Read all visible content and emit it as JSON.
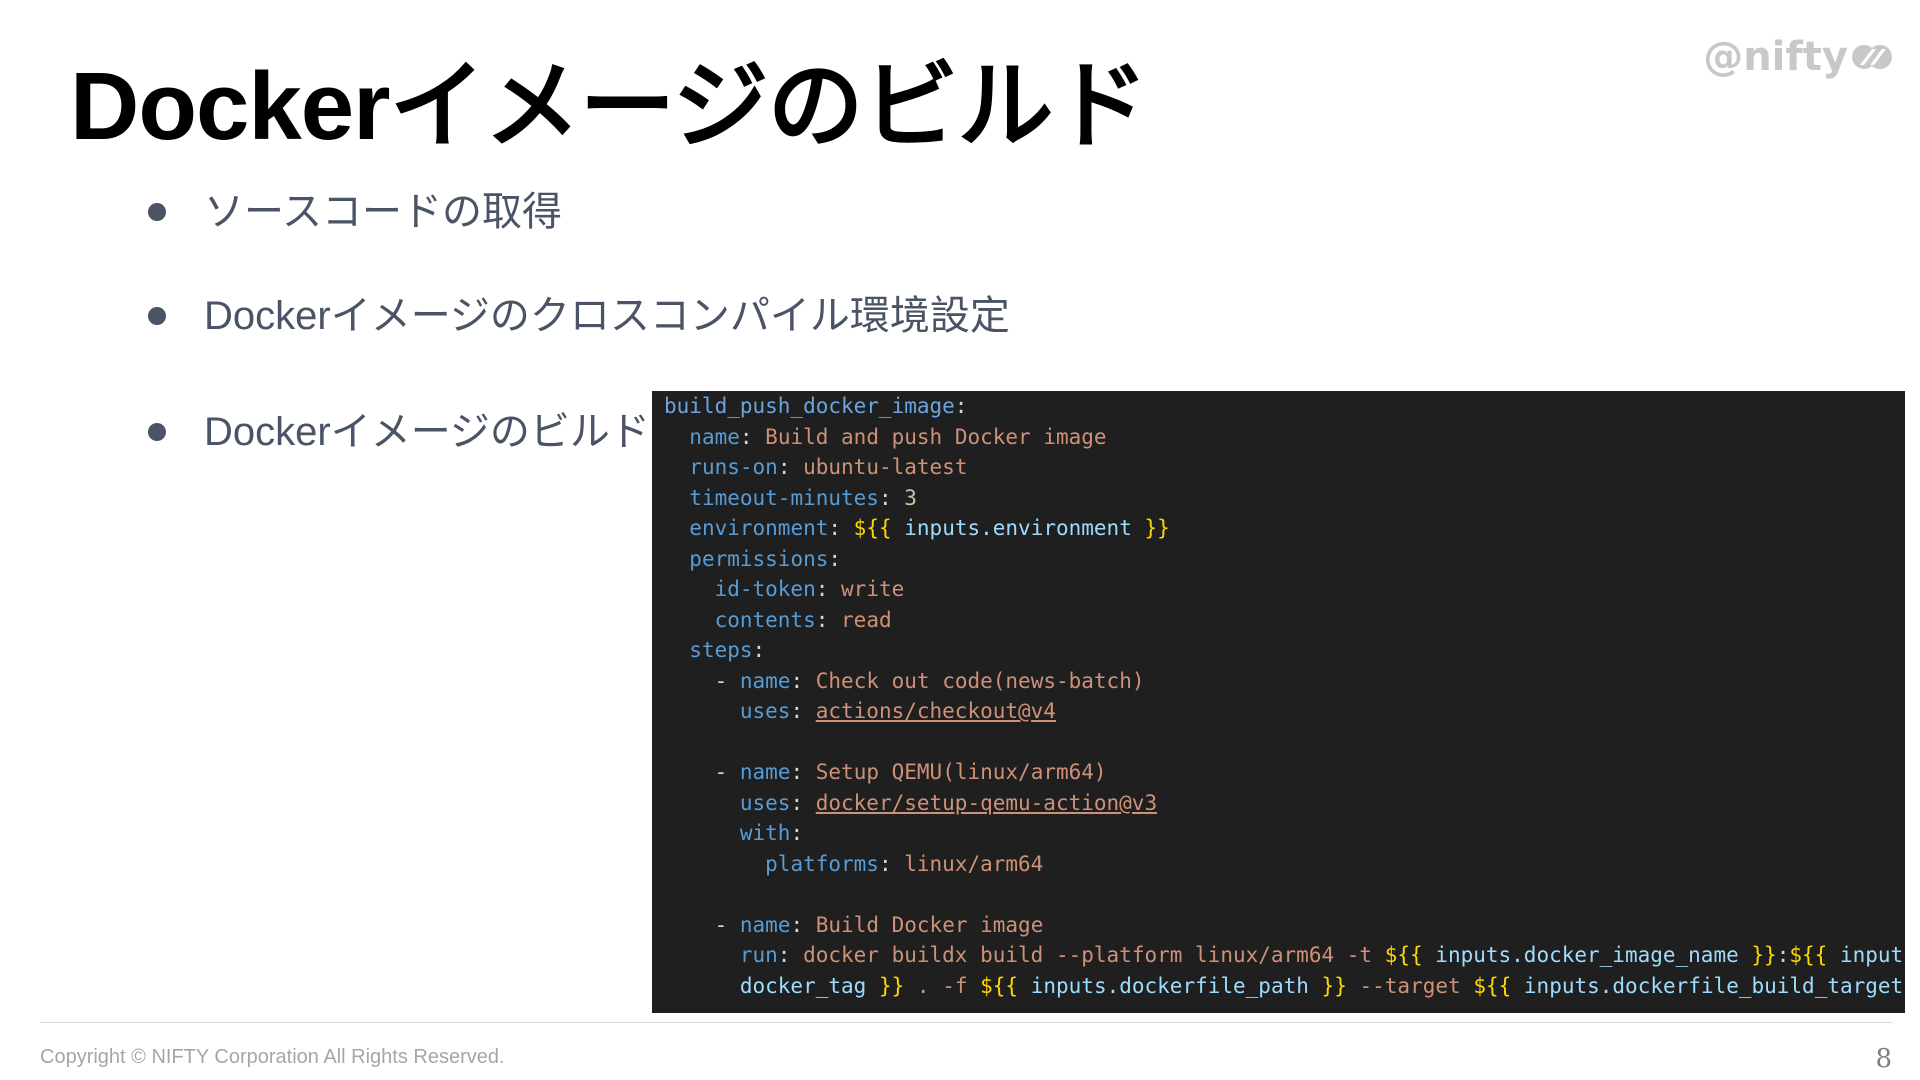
{
  "slide": {
    "title": "Dockerイメージのビルド",
    "logo_text": "@nifty",
    "bullets": [
      "ソースコードの取得",
      "Dockerイメージのクロスコンパイル環境設定",
      "Dockerイメージのビルド"
    ],
    "footer": {
      "copyright": "Copyright © NIFTY Corporation All Rights Reserved.",
      "page_number": "8"
    }
  },
  "code": {
    "job_key": "build_push_docker_image",
    "name_key": "name",
    "name_value": "Build and push Docker image",
    "runs_on_key": "runs-on",
    "runs_on_value": "ubuntu-latest",
    "timeout_key": "timeout-minutes",
    "timeout_value": "3",
    "environment_key": "environment",
    "environment_expr": "inputs.environment",
    "permissions_key": "permissions",
    "id_token_key": "id-token",
    "id_token_value": "write",
    "contents_key": "contents",
    "contents_value": "read",
    "steps_key": "steps",
    "step1_name": "Check out code(news-batch)",
    "step1_uses": "actions/checkout@v4",
    "step2_name": "Setup QEMU(linux/arm64)",
    "step2_uses": "docker/setup-qemu-action@v3",
    "with_key": "with",
    "platforms_key": "platforms",
    "platforms_value": "linux/arm64",
    "step3_name": "Build Docker image",
    "uses_key": "uses",
    "run_key": "run",
    "run_cmd": "docker buildx build --platform linux/arm64 -t",
    "run_expr1": "inputs.docker_image_name",
    "run_expr2_start": "inputs.",
    "run_expr2_end": "docker_tag",
    "run_f": ". -f",
    "run_expr3": "inputs.dockerfile_path",
    "run_target": "--target",
    "run_expr4": "inputs.dockerfile_build_target",
    "expr_open": "${{",
    "expr_close": "}}",
    "dash": "-"
  },
  "colors": {
    "code_bg": "#1f1f1f",
    "key": "#569cd6",
    "string": "#ce9178",
    "number": "#b5cea8",
    "expr_brace": "#ffd700",
    "expr_var": "#9cdcfe",
    "bullet_text": "#4a5466"
  }
}
